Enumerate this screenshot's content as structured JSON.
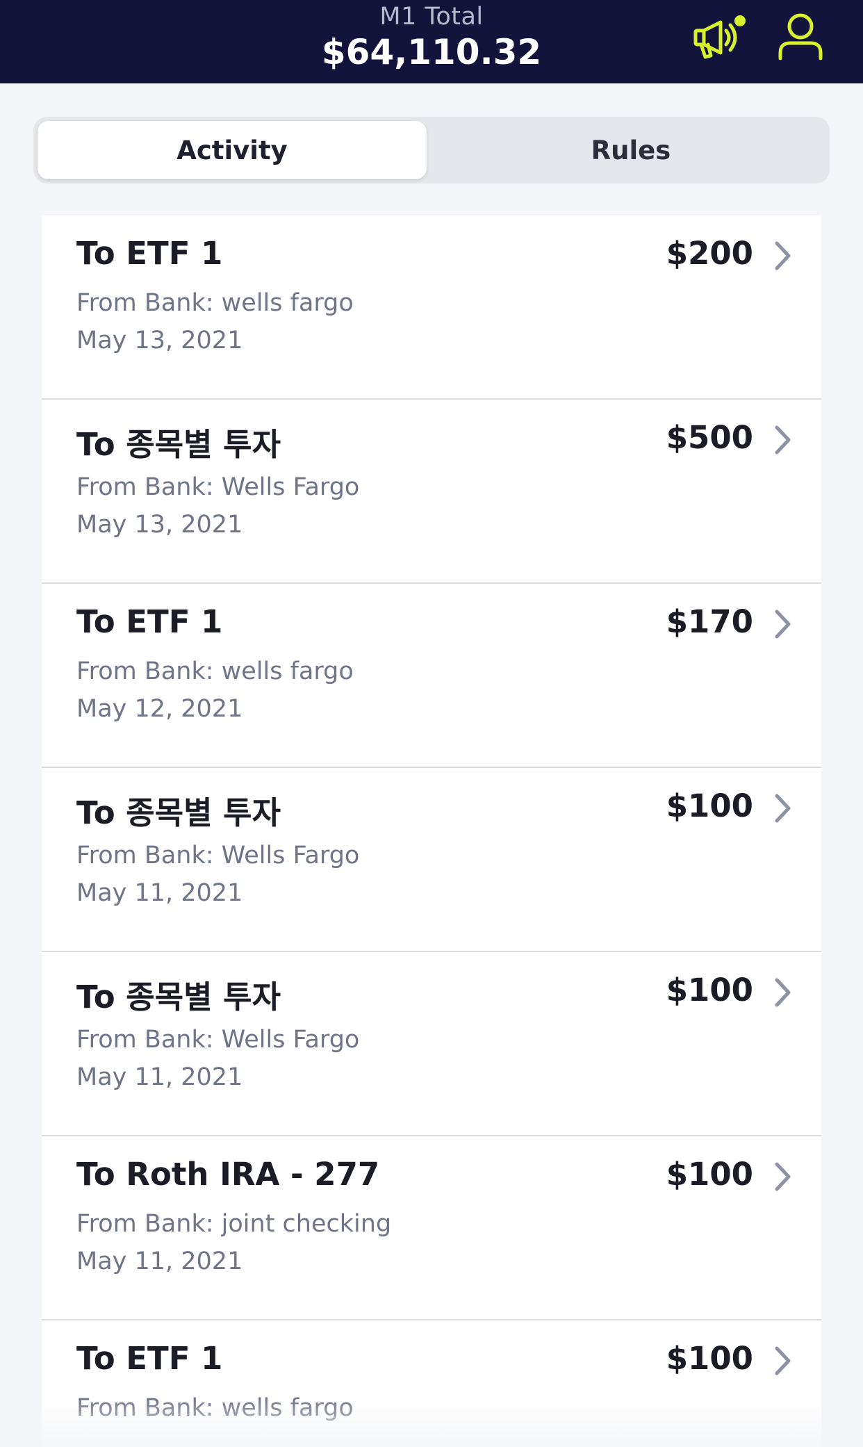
{
  "header": {
    "label": "M1 Total",
    "value": "$64,110.32",
    "accent": "#d7f12c",
    "background": "#13133b",
    "icons": [
      "megaphone-icon",
      "notification-dot",
      "profile-icon"
    ]
  },
  "tabs": [
    {
      "label": "Activity",
      "active": true
    },
    {
      "label": "Rules",
      "active": false
    }
  ],
  "activity": [
    {
      "title": "To ETF 1",
      "amount": "$200",
      "source": "From Bank: wells fargo",
      "date": "May 13, 2021"
    },
    {
      "title": "To 종목별 투자",
      "amount": "$500",
      "source": "From Bank: Wells Fargo",
      "date": "May 13, 2021"
    },
    {
      "title": "To ETF 1",
      "amount": "$170",
      "source": "From Bank: wells fargo",
      "date": "May 12, 2021"
    },
    {
      "title": "To 종목별 투자",
      "amount": "$100",
      "source": "From Bank: Wells Fargo",
      "date": "May 11, 2021"
    },
    {
      "title": "To 종목별 투자",
      "amount": "$100",
      "source": "From Bank: Wells Fargo",
      "date": "May 11, 2021"
    },
    {
      "title": "To Roth IRA - 277",
      "amount": "$100",
      "source": "From Bank: joint checking",
      "date": "May 11, 2021"
    },
    {
      "title": "To ETF 1",
      "amount": "$100",
      "source": "From Bank: wells fargo",
      "date": ""
    }
  ]
}
